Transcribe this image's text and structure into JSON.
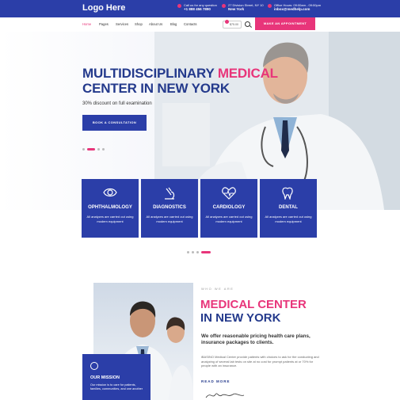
{
  "brand": {
    "logo": "Logo Here",
    "primary": "#2b3ea8",
    "accent": "#e8357a"
  },
  "topbar": {
    "phone_label": "Call us for any question",
    "phone": "+1 888 456 7890",
    "address_line": "27 Division Street, NY 10",
    "address_city": "New York",
    "hours_line": "Office Hours: 09:00am - 09:00pm",
    "email": "inbox@medhelp.com"
  },
  "nav": {
    "items": [
      "Home",
      "Pages",
      "Services",
      "Shop",
      "About Us",
      "Blog",
      "Contacts"
    ],
    "active": "Home",
    "cart_label": "$75.00",
    "appointment_button": "MAKE AN APPOINTMENT"
  },
  "hero": {
    "title_line1_a": "MULTIDISCIPLINARY ",
    "title_line1_b": "MEDICAL",
    "title_line2_a": "CENTER ",
    "title_line2_b": "IN NEW YORK",
    "subtitle": "30% discount on full examination",
    "button": "BOOK A CONSULTATION",
    "slides": 4,
    "active_slide": 1
  },
  "services": [
    {
      "icon": "eye-icon",
      "title": "OPHTHALMOLOGY",
      "text": "All analyzes are carried out using modern equipment"
    },
    {
      "icon": "microscope-icon",
      "title": "DIAGNOSTICS",
      "text": "All analyzes are carried out using modern equipment"
    },
    {
      "icon": "heart-pulse-icon",
      "title": "CARDIOLOGY",
      "text": "All analyzes are carried out using modern equipment"
    },
    {
      "icon": "tooth-icon",
      "title": "DENTAL",
      "text": "All analyzes are carried out using modern equipment"
    }
  ],
  "services_pager": {
    "pages": 4,
    "active": 4
  },
  "about": {
    "eyebrow": "WHO WE ARE",
    "title_line1": "MEDICAL CENTER",
    "title_line2": "IN NEW YORK",
    "lead": "We offer reasonable pricing health care plans, insurance packages to clients.",
    "body": "iBASINO Medical Center provide patients with choices to ask for the conducting and analyzing of several lab tests on site at no cost for prompt patients at or 70% for people with an insurance.",
    "read_more": "READ MORE",
    "mission_title": "OUR MISSION",
    "mission_text": "Our mission is to care for patients, families, communities, and one another"
  }
}
